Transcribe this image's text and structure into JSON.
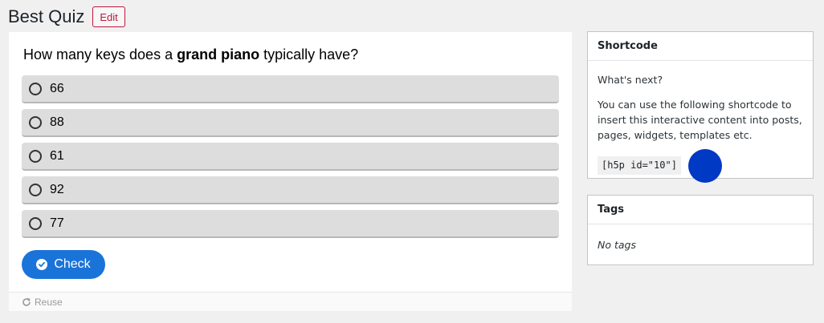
{
  "header": {
    "title": "Best Quiz",
    "edit_label": "Edit"
  },
  "quiz": {
    "question_prefix": "How many keys does a ",
    "question_bold": "grand piano",
    "question_suffix": " typically have?",
    "answers": [
      "66",
      "88",
      "61",
      "92",
      "77"
    ],
    "check_label": "Check",
    "reuse_label": "Reuse"
  },
  "shortcode": {
    "heading": "Shortcode",
    "whats_next": "What's next?",
    "description": "You can use the following shortcode to insert this interactive content into posts, pages, widgets, templates etc.",
    "code": "[h5p id=\"10\"]"
  },
  "tags": {
    "heading": "Tags",
    "empty_text": "No tags"
  },
  "colors": {
    "accent": "#1a73d9",
    "edit_border": "#c0143c",
    "cursor": "#0039c4"
  },
  "icons": {
    "radio": "radio-circle-icon",
    "check": "check-circle-icon",
    "reuse": "refresh-icon"
  }
}
